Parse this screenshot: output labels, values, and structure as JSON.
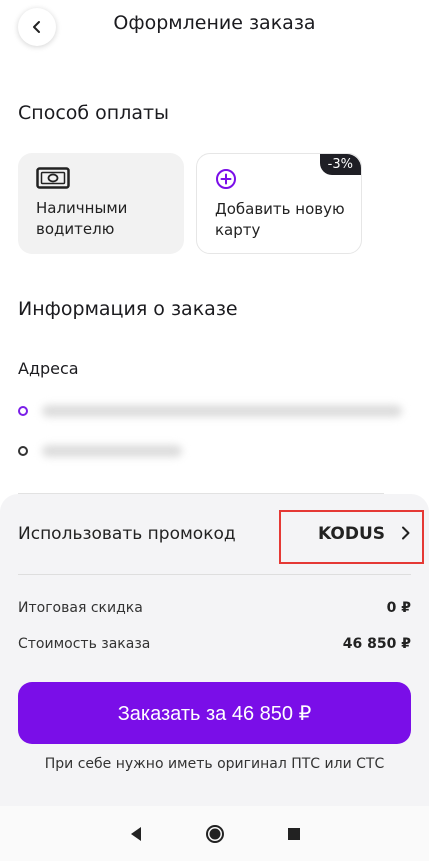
{
  "header": {
    "title": "Оформление заказа"
  },
  "payment": {
    "section_title": "Способ оплаты",
    "cash_label": "Наличными водителю",
    "add_card_label": "Добавить новую карту",
    "discount_badge": "-3%"
  },
  "order_info": {
    "section_title": "Информация о заказе",
    "addresses_title": "Адреса"
  },
  "promo": {
    "label": "Использовать промокод",
    "value": "KODUS"
  },
  "summary": {
    "discount_label": "Итоговая скидка",
    "discount_value": "0 ₽",
    "cost_label": "Стоимость заказа",
    "cost_value": "46 850 ₽"
  },
  "order_button": "Заказать за 46 850 ₽",
  "note": "При себе нужно иметь оригинал ПТС или СТС",
  "colors": {
    "accent": "#7a0ee8",
    "highlight": "#e53935"
  }
}
